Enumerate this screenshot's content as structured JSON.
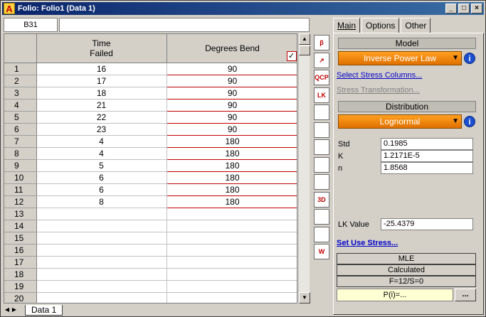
{
  "window": {
    "title": "Folio: Folio1 (Data 1)",
    "app_icon": "A"
  },
  "namebox": "B31",
  "grid": {
    "col_headers": [
      {
        "line1": "Time",
        "line2": "Failed"
      },
      {
        "line1": "Degrees Bend",
        "line2": ""
      }
    ],
    "rows": [
      [
        "1",
        "16",
        "90"
      ],
      [
        "2",
        "17",
        "90"
      ],
      [
        "3",
        "18",
        "90"
      ],
      [
        "4",
        "21",
        "90"
      ],
      [
        "5",
        "22",
        "90"
      ],
      [
        "6",
        "23",
        "90"
      ],
      [
        "7",
        "4",
        "180"
      ],
      [
        "8",
        "4",
        "180"
      ],
      [
        "9",
        "5",
        "180"
      ],
      [
        "10",
        "6",
        "180"
      ],
      [
        "11",
        "6",
        "180"
      ],
      [
        "12",
        "8",
        "180"
      ],
      [
        "13",
        "",
        ""
      ],
      [
        "14",
        "",
        ""
      ],
      [
        "15",
        "",
        ""
      ],
      [
        "16",
        "",
        ""
      ],
      [
        "17",
        "",
        ""
      ],
      [
        "18",
        "",
        ""
      ],
      [
        "19",
        "",
        ""
      ],
      [
        "20",
        "",
        ""
      ]
    ],
    "stress_check": "✓"
  },
  "sheet_tab": "Data 1",
  "tabs": [
    "Main",
    "Options",
    "Other"
  ],
  "model": {
    "header": "Model",
    "value": "Inverse Power Law"
  },
  "links": {
    "select_stress": "Select Stress Columns...",
    "stress_transform": "Stress Transformation...",
    "set_use_stress": "Set Use Stress..."
  },
  "distribution": {
    "header": "Distribution",
    "value": "Lognormal"
  },
  "params": [
    {
      "label": "Std",
      "value": "0.1985"
    },
    {
      "label": "K",
      "value": "1.2171E-5"
    },
    {
      "label": "n",
      "value": "1.8568"
    }
  ],
  "lk": {
    "label": "LK Value",
    "value": "-25.4379"
  },
  "status": {
    "method": "MLE",
    "state": "Calculated",
    "counts": "F=12/S=0"
  },
  "p_value": "P(i)=...",
  "dots": "...",
  "toolbar": [
    "calc",
    "plot",
    "ocp",
    "lk",
    "grid",
    "filter",
    "report",
    "sort",
    "transfer",
    "3d",
    "tag",
    "wizard",
    "w"
  ],
  "toolbar_glyphs": {
    "calc": "β",
    "plot": "↗",
    "ocp": "QCP",
    "lk": "LK",
    "3d": "3D",
    "w": "W"
  }
}
